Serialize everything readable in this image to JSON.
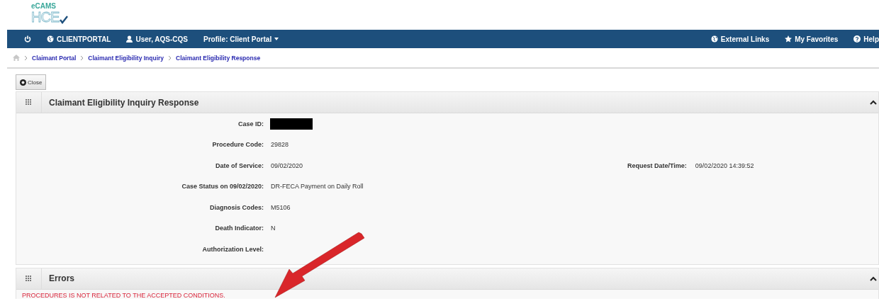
{
  "logo": {
    "top": "eCAMS",
    "bottom": "HCE"
  },
  "navbar": {
    "left": [
      {
        "kind": "power"
      },
      {
        "kind": "globe",
        "label": "CLIENTPORTAL"
      },
      {
        "kind": "user",
        "label": "User, AQS-CQS"
      },
      {
        "kind": "dropdown",
        "label": "Profile: Client Portal"
      }
    ],
    "right": [
      {
        "kind": "globe",
        "label": "External Links"
      },
      {
        "kind": "star",
        "label": "My Favorites"
      },
      {
        "kind": "help",
        "label": "Help"
      }
    ]
  },
  "breadcrumb": [
    "Claimant Portal",
    "Claimant Eligibility Inquiry",
    "Claimant Eligibility Response"
  ],
  "close_button": "Close",
  "response_panel": {
    "title": "Claimant Eligibility Inquiry Response",
    "expanded": true,
    "fields": [
      {
        "label": "Case ID:",
        "kind": "redacted"
      },
      {
        "label": "Procedure Code:",
        "value": "29828",
        "kind": "text"
      },
      {
        "label": "Date of Service:",
        "value": "09/02/2020",
        "kind": "text",
        "aside": {
          "label": "Request Date/Time:",
          "value": "09/02/2020 14:39:52"
        }
      },
      {
        "label": "Case Status on 09/02/2020:",
        "value": "DR-FECA Payment on Daily Roll",
        "kind": "text"
      },
      {
        "label": "Diagnosis Codes:",
        "value": "M5106",
        "kind": "text"
      },
      {
        "label": "Death Indicator:",
        "value": "N",
        "kind": "text"
      },
      {
        "label": "Authorization Level:",
        "kind": "empty"
      }
    ]
  },
  "errors_panel": {
    "title": "Errors",
    "expanded": true,
    "messages": [
      "PROCEDURES IS NOT RELATED TO THE ACCEPTED CONDITIONS."
    ]
  }
}
